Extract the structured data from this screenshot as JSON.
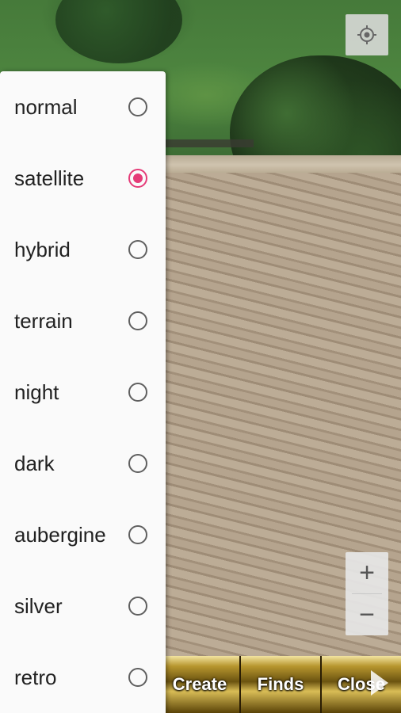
{
  "map": {
    "locate_icon": "crosshair-target-icon",
    "zoom_in": "+",
    "zoom_out": "−"
  },
  "map_type_menu": {
    "selected": "satellite",
    "items": [
      {
        "label": "normal",
        "checked": false
      },
      {
        "label": "satellite",
        "checked": true
      },
      {
        "label": "hybrid",
        "checked": false
      },
      {
        "label": "terrain",
        "checked": false
      },
      {
        "label": "night",
        "checked": false
      },
      {
        "label": "dark",
        "checked": false
      },
      {
        "label": "aubergine",
        "checked": false
      },
      {
        "label": "silver",
        "checked": false
      },
      {
        "label": "retro",
        "checked": false
      }
    ],
    "accent_color": "#e53b78"
  },
  "bottom_bar": {
    "create_label": "Create",
    "finds_label": "Finds",
    "close_label": "Close"
  }
}
